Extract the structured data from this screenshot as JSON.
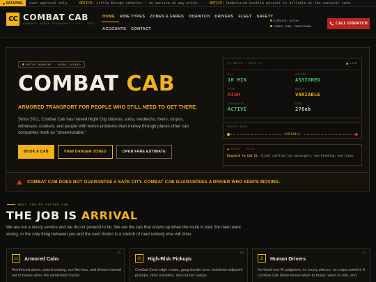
{
  "ticker": {
    "badge": "DATAPOOL",
    "items": [
      {
        "key": "",
        "text": "over approval only."
      },
      {
        "key": "NOTICE:",
        "text": "Little Europe interior — no service at any price."
      },
      {
        "key": "NOTICE:",
        "text": "Undeclared hostile pursuit is billable at the survival rate."
      }
    ]
  },
  "header": {
    "logo_mark": "CC",
    "brand": "COMBAT CAB",
    "brand_sub": "ARMORED URBAN TRANSPORT · EST. 2011",
    "nav_row1": [
      "HOME",
      "RIDE TYPES",
      "ZONES & FARES",
      "DISPATCH",
      "DRIVERS",
      "FLEET",
      "SAFETY"
    ],
    "nav_row2": [
      "ACCOUNTS",
      "CONTACT"
    ],
    "dispatch_status": "DISPATCH: ACTIVE",
    "combat_zone": "COMBAT ZONE: CONDITIONAL",
    "call_label": "CALL DISPATCH",
    "colors": {
      "accent": "#f2b21a",
      "danger": "#b7261b",
      "ok": "#4ec36a"
    }
  },
  "hero": {
    "pill": "METER RUNNING · DOORS LOCKED",
    "title_main": "COMBAT",
    "title_accent": "CAB",
    "tagline": "ARMORED TRANSPORT FOR PEOPLE WHO STILL NEED TO GET THERE.",
    "description": "Since 2011, Combat Cab has moved Night City citizens, solos, medtechs, fixers, corpos, witnesses, couriers, and people with worse problems than money through places other cab companies mark as \"unserviceable.\"",
    "buttons": {
      "book": "BOOK A CAB",
      "danger_zones": "VIEW DANGER ZONES",
      "fare_estimate": "OPEN FARE ESTIMATE"
    }
  },
  "meter": {
    "head": "CC METER · UNIT 27",
    "live": "LIVE",
    "cells": [
      {
        "label": "ETA",
        "value": "10 MIN",
        "tone": "green"
      },
      {
        "label": "DRIVER",
        "value": "ASSIGNED",
        "tone": "green"
      },
      {
        "label": "RISK",
        "value": "HIGH",
        "tone": "red"
      },
      {
        "label": "ROUTE",
        "value": "VARIABLE",
        "tone": "yellow"
      },
      {
        "label": "SURCHARGE",
        "value": "ACTIVE",
        "tone": "green"
      },
      {
        "label": "FARE",
        "value": "276eb",
        "tone": "gray"
      }
    ],
    "danger_label": "DANGER BAND",
    "danger_value": "VARIABLE",
    "radio_label": "RADIO · 19:40",
    "radio_from": "Dispatch to Cab 31:",
    "radio_msg": "client confirms two passengers, one bleeding, one lying."
  },
  "warning": {
    "text": "COMBAT CAB DOES NOT GUARANTEE A SAFE CITY. COMBAT CAB GUARANTEES A DRIVER WHO KEEPS MOVING."
  },
  "section": {
    "eyebrow": "WHAT YOU'RE PAYING FOR",
    "title_main": "THE JOB IS",
    "title_accent": "ARRIVAL",
    "description": "We are not a luxury service and we do not pretend to be. We are the cab that shows up when the route is bad, the meet went wrong, or the only thing between you and the next district is a stretch of road nobody else will drive."
  },
  "cards": [
    {
      "num": "01",
      "icon": "▭",
      "title": "Armored Cabs",
      "body": "Reinforced doors, plated seating, run-flat tires, and drivers trained not to freeze when the windshield cracks."
    },
    {
      "num": "02",
      "icon": "◎",
      "title": "High-Risk Pickups",
      "body": "Combat Zone edge routes, gang-border runs, lockdown-adjacent pickups, clinic transfers, and courier swaps."
    },
    {
      "num": "03",
      "icon": "♙",
      "title": "Human Drivers",
      "body": "No black-box AI judgment, no luxury silence, no corpo comfort. A Combat Cab driver knows when to brake, when to ram, and"
    }
  ]
}
